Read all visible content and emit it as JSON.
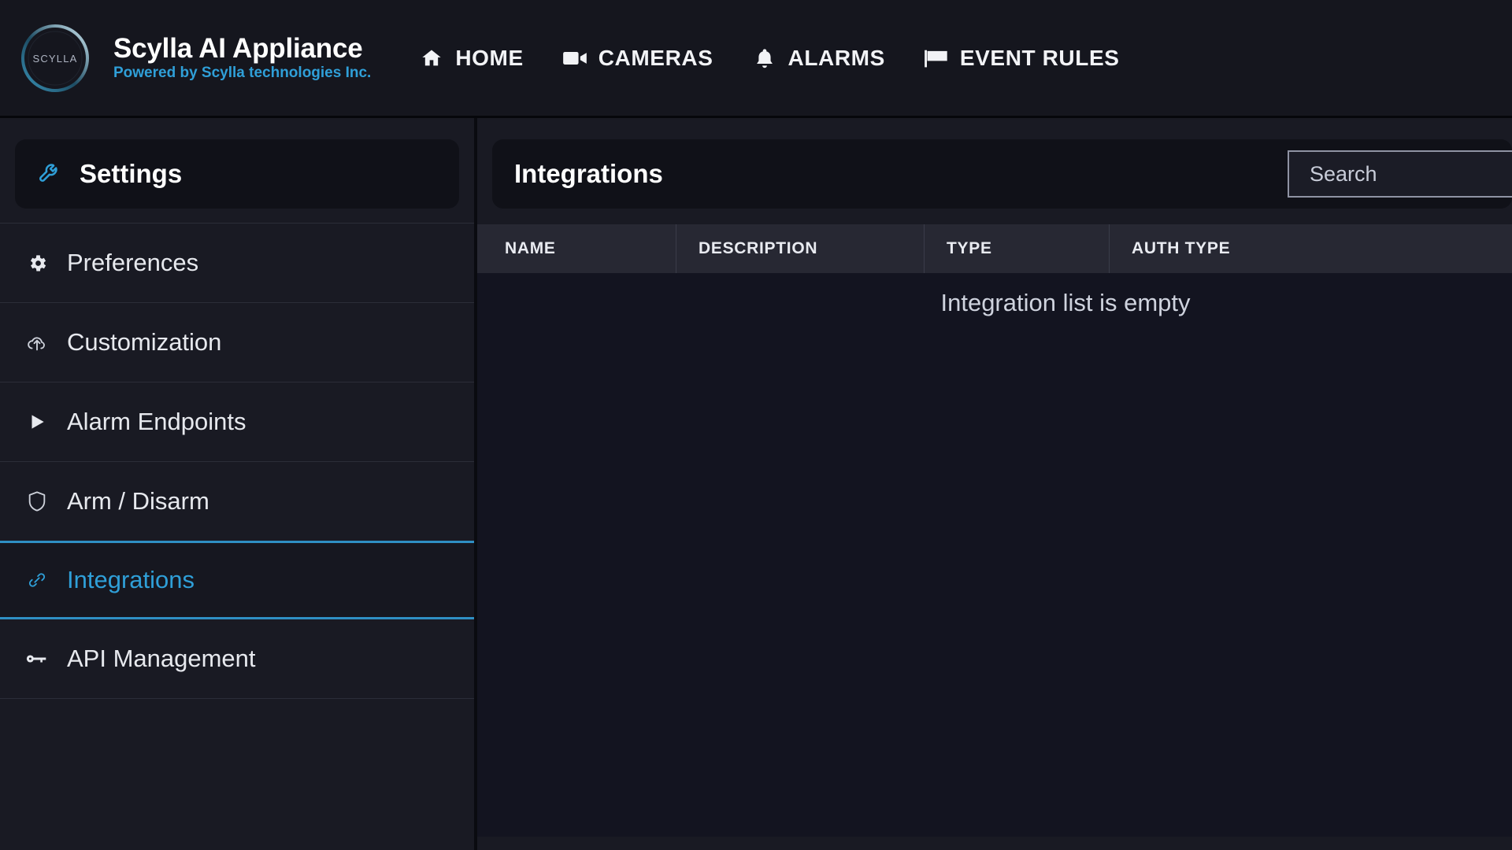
{
  "brand": {
    "logo_text": "SCYLLA",
    "title": "Scylla AI Appliance",
    "subtitle": "Powered by Scylla technologies Inc.",
    "accent_color": "#2f9fd8"
  },
  "nav": {
    "items": [
      {
        "label": "HOME",
        "icon": "home-icon"
      },
      {
        "label": "CAMERAS",
        "icon": "video-camera-icon"
      },
      {
        "label": "ALARMS",
        "icon": "bell-icon"
      },
      {
        "label": "EVENT RULES",
        "icon": "flag-icon"
      }
    ]
  },
  "sidebar": {
    "header": {
      "label": "Settings",
      "icon": "wrench-icon"
    },
    "items": [
      {
        "label": "Preferences",
        "icon": "gear-icon",
        "active": false
      },
      {
        "label": "Customization",
        "icon": "cloud-upload-icon",
        "active": false
      },
      {
        "label": "Alarm Endpoints",
        "icon": "play-arrow-icon",
        "active": false
      },
      {
        "label": "Arm / Disarm",
        "icon": "shield-icon",
        "active": false
      },
      {
        "label": "Integrations",
        "icon": "link-icon",
        "active": true
      },
      {
        "label": "API Management",
        "icon": "key-icon",
        "active": false
      }
    ]
  },
  "main": {
    "title": "Integrations",
    "search": {
      "placeholder": "Search",
      "value": ""
    },
    "table": {
      "columns": [
        "NAME",
        "DESCRIPTION",
        "TYPE",
        "AUTH TYPE"
      ],
      "rows": [],
      "empty_message": "Integration list is empty"
    }
  }
}
